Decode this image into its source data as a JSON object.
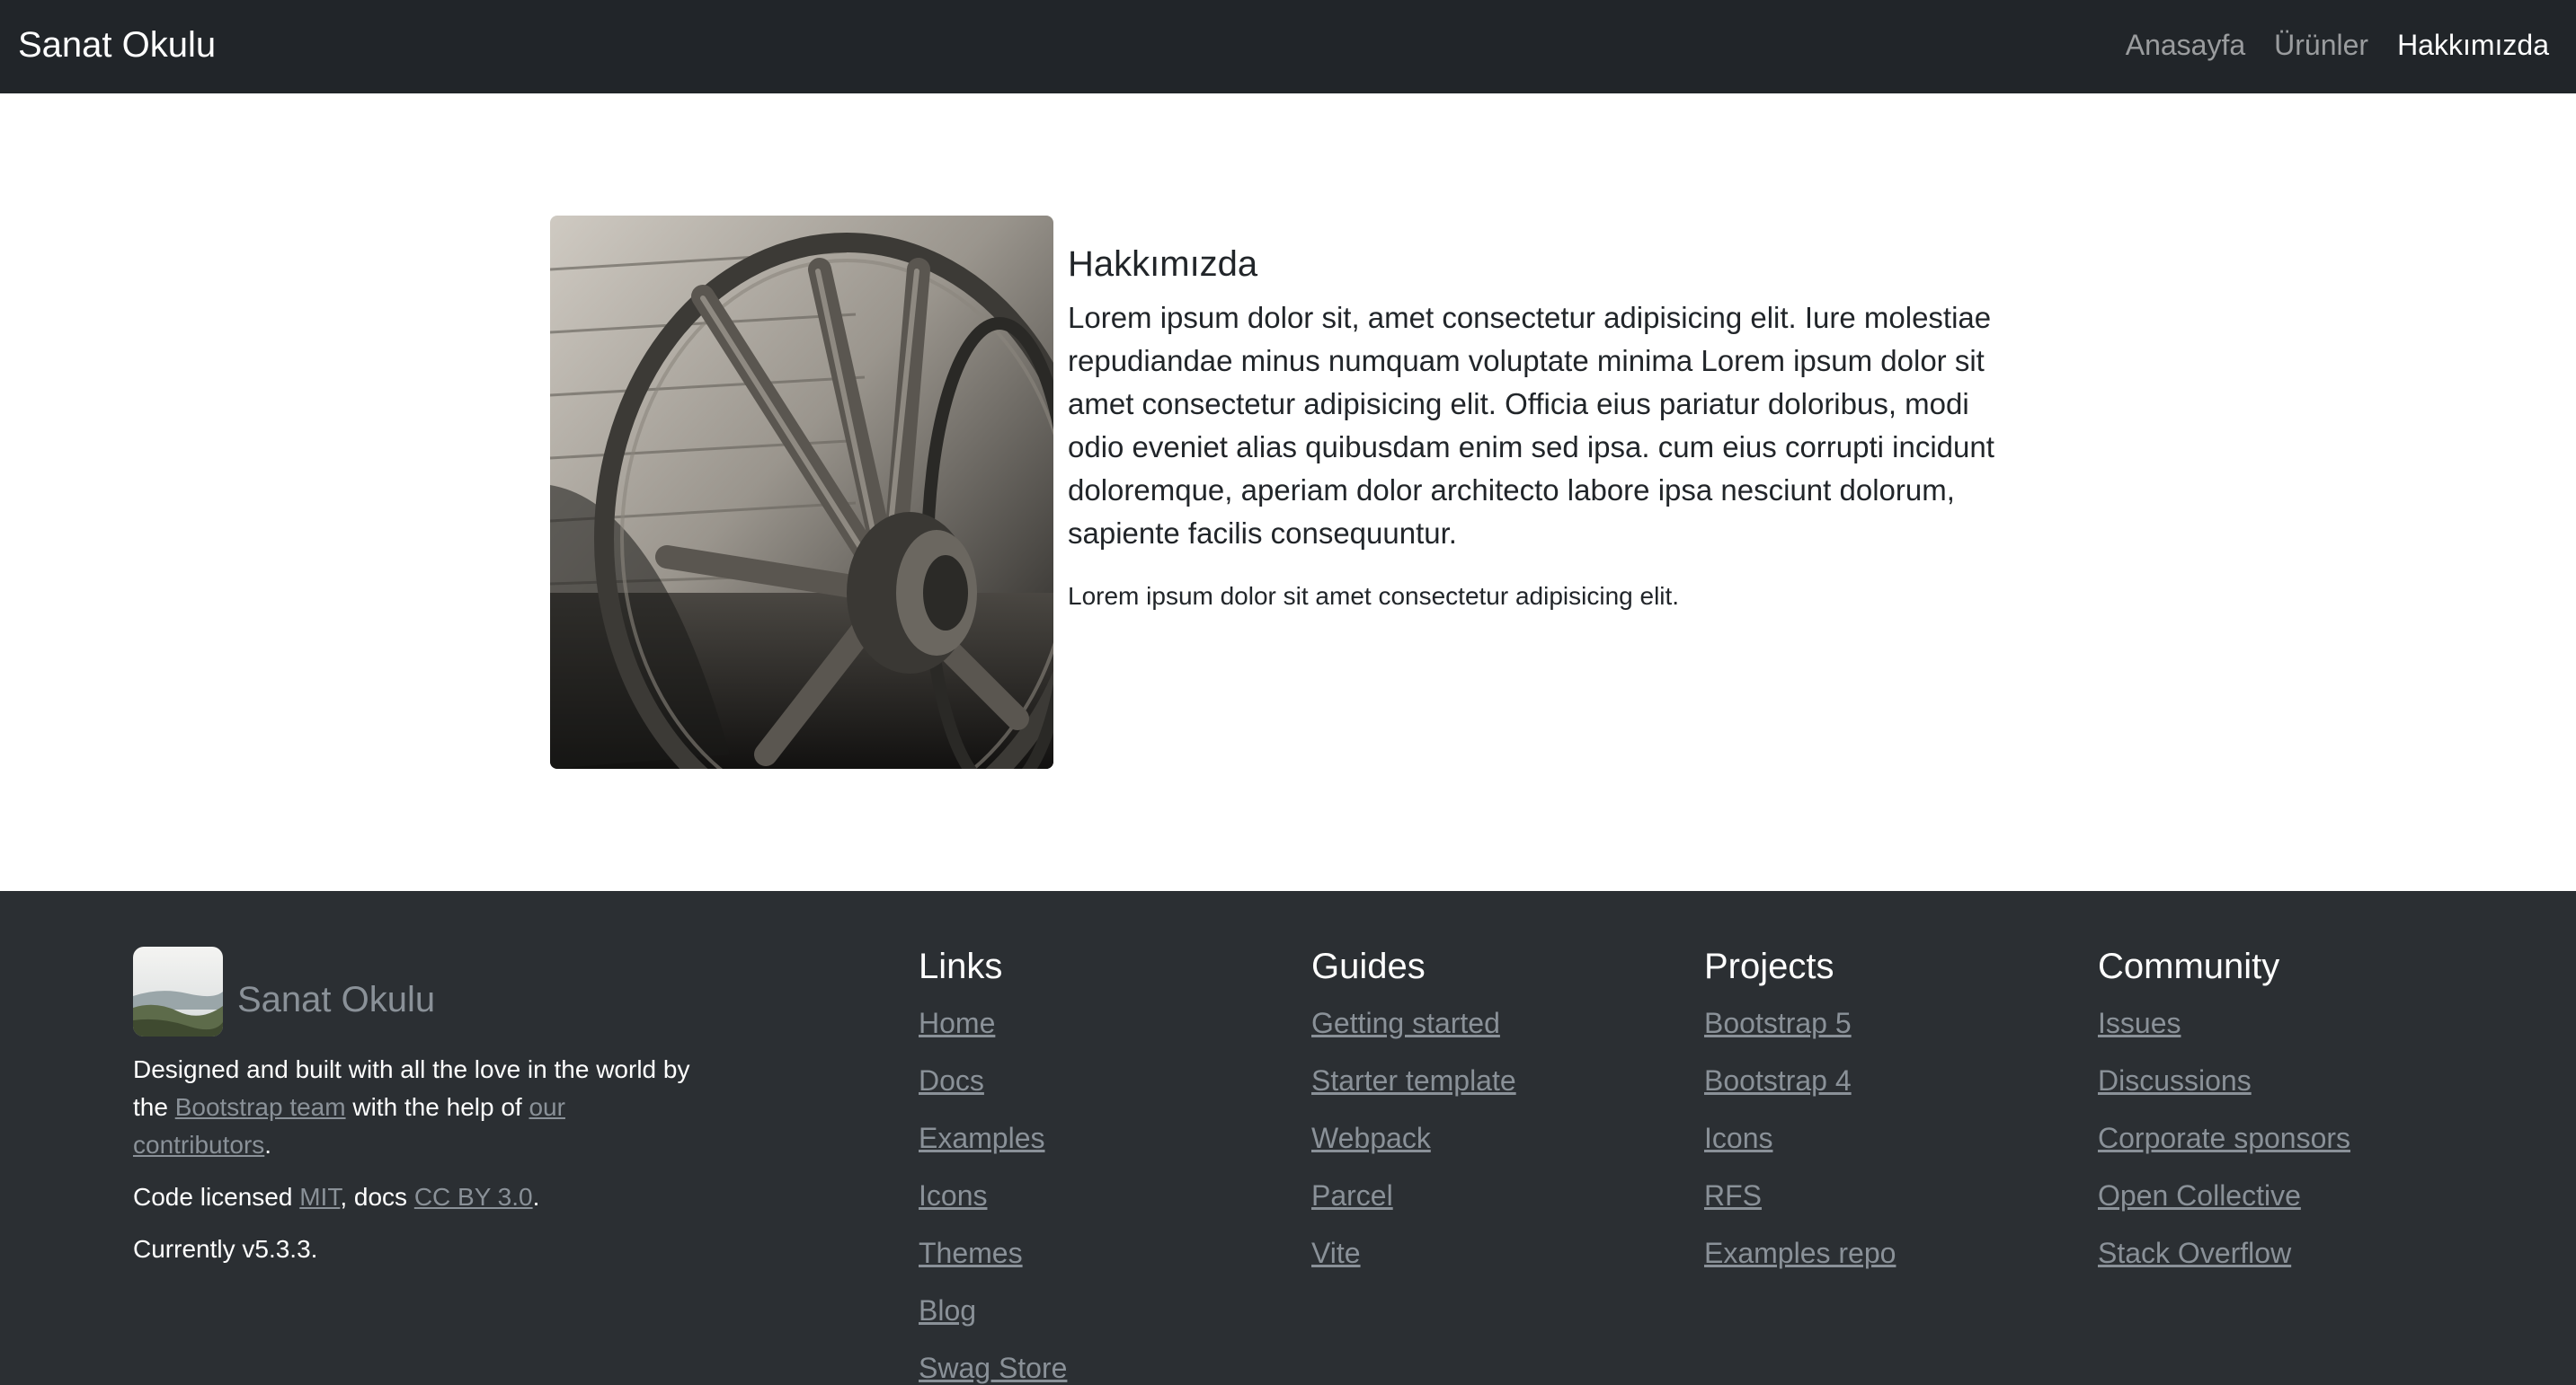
{
  "navbar": {
    "brand": "Sanat Okulu",
    "links": [
      {
        "label": "Anasayfa",
        "active": false
      },
      {
        "label": "Ürünler",
        "active": false
      },
      {
        "label": "Hakkımızda",
        "active": true
      }
    ]
  },
  "about": {
    "image_icon": "wagon-wheel-photo",
    "title": "Hakkımızda",
    "lead": "Lorem ipsum dolor sit, amet consectetur adipisicing elit. Iure molestiae repudiandae minus numquam voluptate minima Lorem ipsum dolor sit amet consectetur adipisicing elit. Officia eius pariatur doloribus, modi odio eveniet alias quibusdam enim sed ipsa. cum eius corrupti incidunt doloremque, aperiam dolor architecto labore ipsa nesciunt dolorum, sapiente facilis consequuntur.",
    "small": "Lorem ipsum dolor sit amet consectetur adipisicing elit."
  },
  "footer": {
    "brand": "Sanat Okulu",
    "desc": {
      "line1_prefix": "Designed and built with all the love in the world by the ",
      "bootstrap_team": "Bootstrap team",
      "line1_middle": " with the help of ",
      "contributors": "our contributors",
      "line1_suffix": ".",
      "license_prefix": "Code licensed ",
      "mit": "MIT",
      "license_middle": ", docs ",
      "cc": "CC BY 3.0",
      "license_suffix": ".",
      "version": "Currently v5.3.3."
    },
    "columns": [
      {
        "title": "Links",
        "items": [
          "Home",
          "Docs",
          "Examples",
          "Icons",
          "Themes",
          "Blog",
          "Swag Store"
        ]
      },
      {
        "title": "Guides",
        "items": [
          "Getting started",
          "Starter template",
          "Webpack",
          "Parcel",
          "Vite"
        ]
      },
      {
        "title": "Projects",
        "items": [
          "Bootstrap 5",
          "Bootstrap 4",
          "Icons",
          "RFS",
          "Examples repo"
        ]
      },
      {
        "title": "Community",
        "items": [
          "Issues",
          "Discussions",
          "Corporate sponsors",
          "Open Collective",
          "Stack Overflow"
        ]
      }
    ]
  },
  "colors": {
    "navbar_bg": "#212529",
    "footer_bg": "#2b2f33",
    "link_muted": "#8a9198"
  }
}
